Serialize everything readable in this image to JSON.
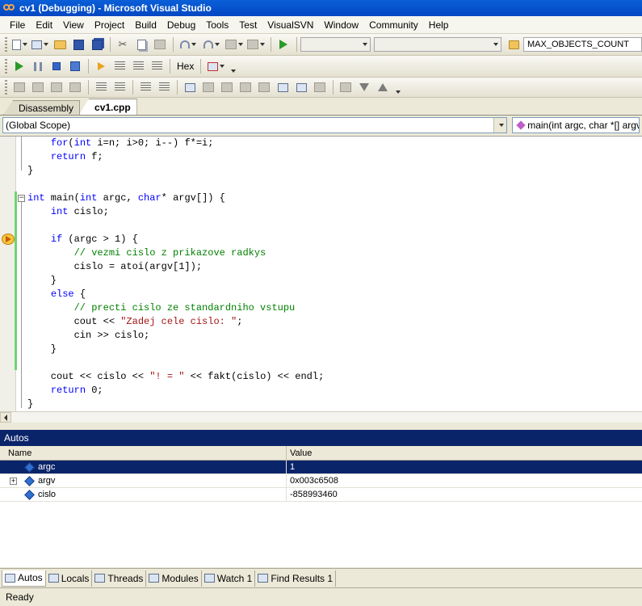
{
  "window": {
    "title": "cv1 (Debugging) - Microsoft Visual Studio"
  },
  "menu": [
    "File",
    "Edit",
    "View",
    "Project",
    "Build",
    "Debug",
    "Tools",
    "Test",
    "VisualSVN",
    "Window",
    "Community",
    "Help"
  ],
  "toolbar": {
    "find_value": "MAX_OBJECTS_COUNT",
    "hex_label": "Hex"
  },
  "doc_tabs": [
    "Disassembly",
    "cv1.cpp"
  ],
  "scope": {
    "scope_value": "(Global Scope)",
    "member_value": "main(int argc, char *[] argv"
  },
  "code": [
    [
      {
        "t": "    "
      },
      {
        "t": "for",
        "c": "kw"
      },
      {
        "t": "("
      },
      {
        "t": "int",
        "c": "kw"
      },
      {
        "t": " i=n; i>0; i--) f*=i;"
      }
    ],
    [
      {
        "t": "    "
      },
      {
        "t": "return",
        "c": "kw"
      },
      {
        "t": " f;"
      }
    ],
    [
      {
        "t": "}"
      }
    ],
    [
      {
        "t": ""
      }
    ],
    [
      {
        "t": "int",
        "c": "kw"
      },
      {
        "t": " main("
      },
      {
        "t": "int",
        "c": "kw"
      },
      {
        "t": " argc, "
      },
      {
        "t": "char",
        "c": "kw"
      },
      {
        "t": "* argv[]) {"
      }
    ],
    [
      {
        "t": "    "
      },
      {
        "t": "int",
        "c": "kw"
      },
      {
        "t": " cislo;"
      }
    ],
    [
      {
        "t": ""
      }
    ],
    [
      {
        "t": "    "
      },
      {
        "t": "if",
        "c": "kw"
      },
      {
        "t": " (argc > 1) {"
      }
    ],
    [
      {
        "t": "        "
      },
      {
        "t": "// vezmi cislo z prikazove radkys",
        "c": "cm"
      }
    ],
    [
      {
        "t": "        cislo = atoi(argv[1]);"
      }
    ],
    [
      {
        "t": "    }"
      }
    ],
    [
      {
        "t": "    "
      },
      {
        "t": "else",
        "c": "kw"
      },
      {
        "t": " {"
      }
    ],
    [
      {
        "t": "        "
      },
      {
        "t": "// precti cislo ze standardniho vstupu",
        "c": "cm"
      }
    ],
    [
      {
        "t": "        cout << "
      },
      {
        "t": "\"Zadej cele cislo: \"",
        "c": "st"
      },
      {
        "t": ";"
      }
    ],
    [
      {
        "t": "        cin >> cislo;"
      }
    ],
    [
      {
        "t": "    }"
      }
    ],
    [
      {
        "t": ""
      }
    ],
    [
      {
        "t": "    cout << cislo << "
      },
      {
        "t": "\"! = \"",
        "c": "st"
      },
      {
        "t": " << fakt(cislo) << endl;"
      }
    ],
    [
      {
        "t": "    "
      },
      {
        "t": "return",
        "c": "kw"
      },
      {
        "t": " 0;"
      }
    ],
    [
      {
        "t": "}"
      }
    ]
  ],
  "autos": {
    "title": "Autos",
    "columns": [
      "Name",
      "Value"
    ],
    "rows": [
      {
        "name": "argc",
        "value": "1",
        "selected": true,
        "expandable": false
      },
      {
        "name": "argv",
        "value": "0x003c6508",
        "selected": false,
        "expandable": true
      },
      {
        "name": "cislo",
        "value": "-858993460",
        "selected": false,
        "expandable": false
      }
    ]
  },
  "bottom_tabs": [
    "Autos",
    "Locals",
    "Threads",
    "Modules",
    "Watch 1",
    "Find Results 1"
  ],
  "status": "Ready",
  "colors": {
    "keyword": "#0000ff",
    "comment": "#008000",
    "string": "#a31515",
    "selection": "#0a246a",
    "title_bar": "#0a5fd8"
  }
}
